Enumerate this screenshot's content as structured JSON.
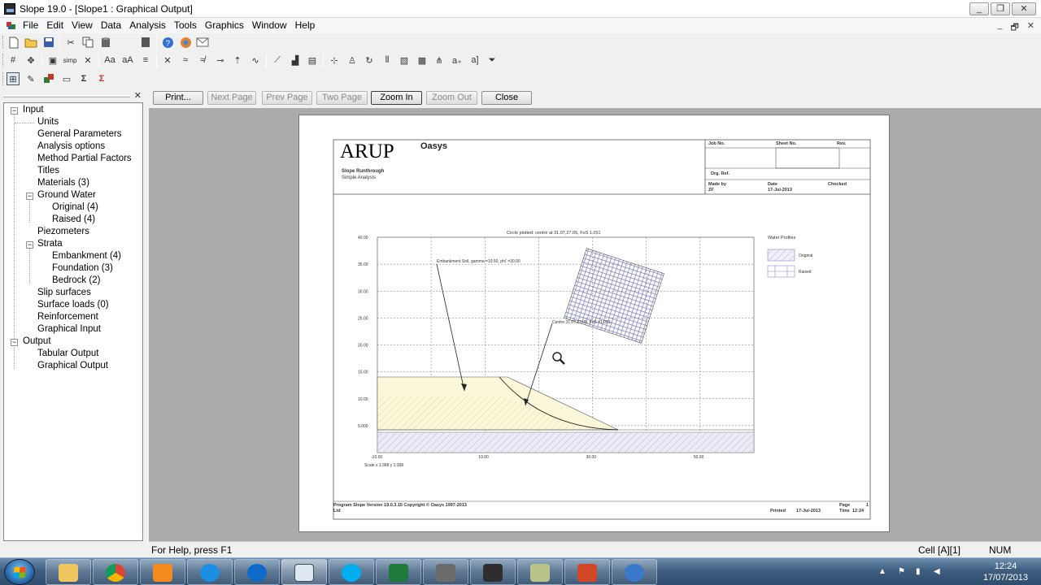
{
  "window": {
    "title": "Slope 19.0 - [Slope1 : Graphical Output]",
    "controls": [
      "_",
      "❐",
      "✕"
    ]
  },
  "menubar": {
    "items": [
      "File",
      "Edit",
      "View",
      "Data",
      "Analysis",
      "Tools",
      "Graphics",
      "Window",
      "Help"
    ],
    "mdi_controls": [
      "_",
      "🗗",
      "✕"
    ]
  },
  "tree": {
    "close_label": "✕",
    "nodes": [
      {
        "label": "Input",
        "level": 0,
        "expander": "−"
      },
      {
        "label": "Units",
        "level": 1
      },
      {
        "label": "General Parameters",
        "level": 1
      },
      {
        "label": "Analysis options",
        "level": 1
      },
      {
        "label": "Method Partial Factors",
        "level": 1
      },
      {
        "label": "Titles",
        "level": 1
      },
      {
        "label": "Materials (3)",
        "level": 1
      },
      {
        "label": "Ground Water",
        "level": 1,
        "expander": "−"
      },
      {
        "label": "Original (4)",
        "level": 2
      },
      {
        "label": "Raised (4)",
        "level": 2
      },
      {
        "label": "Piezometers",
        "level": 1
      },
      {
        "label": "Strata",
        "level": 1,
        "expander": "−"
      },
      {
        "label": "Embankment (4)",
        "level": 2
      },
      {
        "label": "Foundation (3)",
        "level": 2
      },
      {
        "label": "Bedrock (2)",
        "level": 2
      },
      {
        "label": "Slip surfaces",
        "level": 1
      },
      {
        "label": "Surface loads (0)",
        "level": 1
      },
      {
        "label": "Reinforcement",
        "level": 1
      },
      {
        "label": "Graphical Input",
        "level": 1
      },
      {
        "label": "Output",
        "level": 0,
        "expander": "−"
      },
      {
        "label": "Tabular Output",
        "level": 1
      },
      {
        "label": "Graphical Output",
        "level": 1
      }
    ]
  },
  "preview_buttons": [
    {
      "label": "Print...",
      "state": "enabled"
    },
    {
      "label": "Next Page",
      "state": "disabled"
    },
    {
      "label": "Prev Page",
      "state": "disabled"
    },
    {
      "label": "Two Page",
      "state": "disabled"
    },
    {
      "label": "Zoom In",
      "state": "pressed"
    },
    {
      "label": "Zoom Out",
      "state": "disabled"
    },
    {
      "label": "Close",
      "state": "enabled"
    }
  ],
  "report": {
    "logo": "ARUP",
    "product": "Oasys",
    "job_title": "Slope Runthrough",
    "subtitle": "Simple Analysis",
    "job_no_label": "Job No.",
    "sheet_no_label": "Sheet No.",
    "rev_label": "Rev.",
    "org_ref_label": "Drg. Ref.",
    "made_by_label": "Made by",
    "made_by": "ZF",
    "date_label": "Date",
    "date": "17-Jul-2013",
    "checked_label": "Checked",
    "footer_program": "Program Slope Version 19.0.3.15  Copyright © Oasys 1997-2013",
    "footer_ltd": "Ltd",
    "printed_label": "Printed",
    "printed_date": "17-Jul-2013",
    "page_label": "Page",
    "page_no": "1",
    "time_label": "Time",
    "time": "12:24"
  },
  "chart_data": {
    "type": "diagram",
    "title": "Circle plotted: centre at 31.07,27.05, FoS  1.051",
    "x_ticks": [
      "-10.00",
      "10.00",
      "30.00",
      "50.00"
    ],
    "y_ticks": [
      "40.00",
      "35.00",
      "30.00",
      "25.00",
      "20.00",
      "15.00",
      "10.00",
      "5.000"
    ],
    "x_range": [
      -10,
      60
    ],
    "y_range": [
      0,
      40
    ],
    "scale_note": "Scale x 1:368  y 1:368",
    "annotation_material": "Embankment Soil, gamma =19.50, phi' =30.00",
    "annotation_centre": "Centre 31.07,27.05, FoS =1.051",
    "legend_title": "Water Profiles",
    "legend_items": [
      "Original",
      "Raised"
    ],
    "ground_surface": [
      [
        -10,
        14.5
      ],
      [
        13.5,
        14.5
      ],
      [
        33,
        4.5
      ],
      [
        60,
        4.5
      ]
    ]
  },
  "status": {
    "help": "For Help, press F1",
    "cell": "Cell [A][1]",
    "num": "NUM"
  },
  "taskbar": {
    "time": "12:24",
    "date": "17/07/2013"
  }
}
